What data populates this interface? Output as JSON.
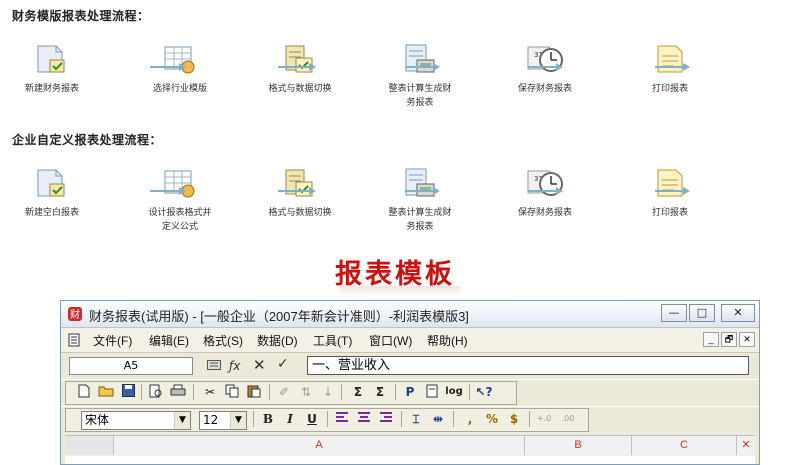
{
  "flow1": {
    "title": "财务模版报表处理流程：",
    "steps": [
      {
        "icon": "new-report-icon",
        "label": "新建财务报表"
      },
      {
        "icon": "industry-template-icon",
        "label": "选择行业模版"
      },
      {
        "icon": "format-data-switch-icon",
        "label": "格式与数据切换"
      },
      {
        "icon": "calculate-report-icon",
        "label": "整表计算生成财务报表"
      },
      {
        "icon": "save-clock-icon",
        "label": "保存财务报表"
      },
      {
        "icon": "print-report-icon",
        "label": "打印报表"
      }
    ]
  },
  "flow2": {
    "title": "企业自定义报表处理流程：",
    "steps": [
      {
        "icon": "new-blank-report-icon",
        "label": "新建空白报表"
      },
      {
        "icon": "design-format-icon",
        "label": "设计报表格式并定义公式"
      },
      {
        "icon": "format-data-switch-icon",
        "label": "格式与数据切换"
      },
      {
        "icon": "calculate-report-icon",
        "label": "整表计算生成财务报表"
      },
      {
        "icon": "save-clock-icon",
        "label": "保存财务报表"
      },
      {
        "icon": "print-report-icon",
        "label": "打印报表"
      }
    ]
  },
  "heading": "报表模板",
  "app": {
    "title": "财务报表(试用版) - [一般企业（2007年新会计准则）-利润表模版3]",
    "window_buttons": [
      "—",
      "□",
      "✕"
    ],
    "menu": [
      "文件(F)",
      "编辑(E)",
      "格式(S)",
      "数据(D)",
      "工具(T)",
      "窗口(W)",
      "帮助(H)"
    ],
    "mdi_buttons": [
      "_",
      "🗗",
      "✕"
    ],
    "cell_ref": "A5",
    "formula": "一、营业收入",
    "font_name": "宋体",
    "font_size": "12",
    "columns": [
      "A",
      "B",
      "C"
    ]
  },
  "colors": {
    "heading": "#cc1111",
    "column_header_text": "#c0392b",
    "arrow": "#7fb0c8"
  }
}
